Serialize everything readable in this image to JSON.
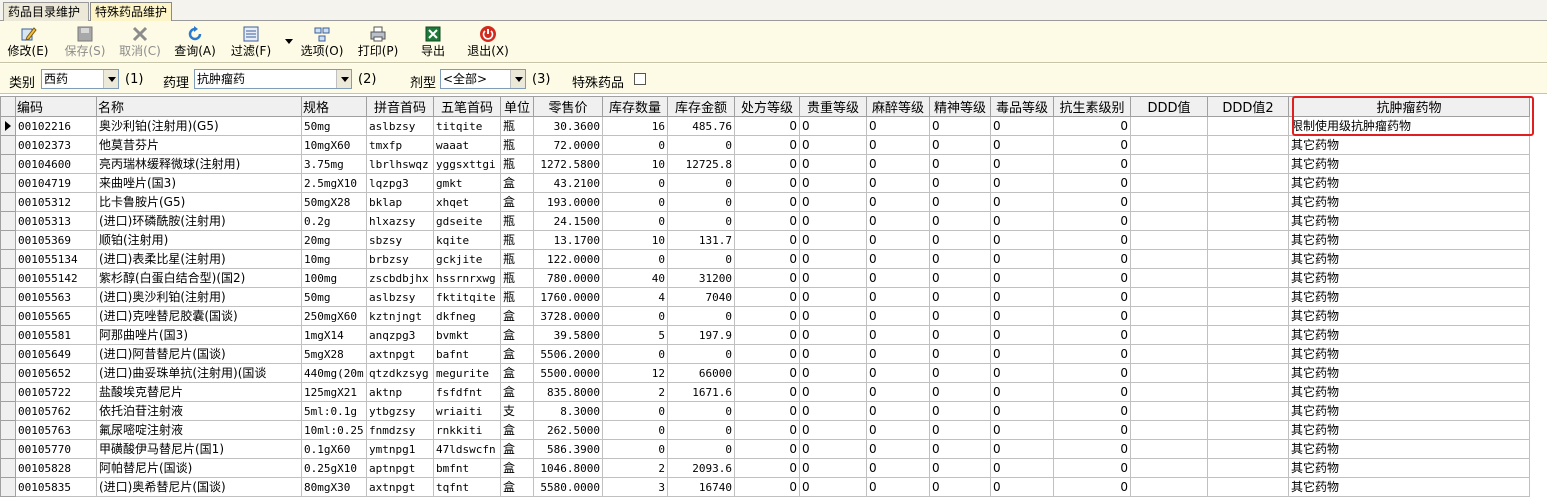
{
  "tabs": [
    {
      "label": "药品目录维护"
    },
    {
      "label": "特殊药品维护"
    }
  ],
  "toolbar": {
    "buttons": [
      {
        "label": "修改(E)",
        "icon": "edit-icon",
        "enabled": true
      },
      {
        "label": "保存(S)",
        "icon": "save-icon",
        "enabled": false
      },
      {
        "label": "取消(C)",
        "icon": "cancel-icon",
        "enabled": false
      },
      {
        "label": "查询(A)",
        "icon": "refresh-icon",
        "enabled": true
      },
      {
        "label": "过滤(F)",
        "icon": "filter-icon",
        "enabled": true
      },
      {
        "label": "选项(O)",
        "icon": "options-icon",
        "enabled": true
      },
      {
        "label": "打印(P)",
        "icon": "print-icon",
        "enabled": true
      },
      {
        "label": "导出",
        "icon": "excel-export-icon",
        "enabled": true
      },
      {
        "label": "退出(X)",
        "icon": "exit-power-icon",
        "enabled": true
      }
    ]
  },
  "filters": {
    "category_label": "类别",
    "category_value": "西药",
    "category_shortcut": "(1)",
    "pharm_label": "药理",
    "pharm_value": "抗肿瘤药",
    "pharm_shortcut": "(2)",
    "form_label": "剂型",
    "form_value": "<全部>",
    "form_shortcut": "(3)",
    "special_label": "特殊药品",
    "special_checked": false
  },
  "grid": {
    "columns": [
      "编码",
      "名称",
      "规格",
      "拼音首码",
      "五笔首码",
      "单位",
      "零售价",
      "库存数量",
      "库存金额",
      "处方等级",
      "贵重等级",
      "麻醉等级",
      "精神等级",
      "毒品等级",
      "抗生素级别",
      "DDD值",
      "DDD值2",
      "抗肿瘤药物"
    ],
    "rows": [
      [
        "00102216",
        "奥沙利铂(注射用)(G5)",
        "50mg",
        "aslbzsy",
        "titqite",
        "瓶",
        "30.3600",
        "16",
        "485.76",
        "0",
        "0",
        "0",
        "0",
        "0",
        "0",
        "",
        "",
        "限制使用级抗肿瘤药物"
      ],
      [
        "00102373",
        "他莫昔芬片",
        "10mgX60",
        "tmxfp",
        "waaat",
        "瓶",
        "72.0000",
        "0",
        "0",
        "0",
        "0",
        "0",
        "0",
        "0",
        "0",
        "",
        "",
        "其它药物"
      ],
      [
        "00104600",
        "亮丙瑞林缓释微球(注射用)",
        "3.75mg",
        "lbrlhswqz",
        "yggsxttgi",
        "瓶",
        "1272.5800",
        "10",
        "12725.8",
        "0",
        "0",
        "0",
        "0",
        "0",
        "0",
        "",
        "",
        "其它药物"
      ],
      [
        "00104719",
        "来曲唑片(国3)",
        "2.5mgX10",
        "lqzpg3",
        "gmkt",
        "盒",
        "43.2100",
        "0",
        "0",
        "0",
        "0",
        "0",
        "0",
        "0",
        "0",
        "",
        "",
        "其它药物"
      ],
      [
        "00105312",
        "比卡鲁胺片(G5)",
        "50mgX28",
        "bklap",
        "xhqet",
        "盒",
        "193.0000",
        "0",
        "0",
        "0",
        "0",
        "0",
        "0",
        "0",
        "0",
        "",
        "",
        "其它药物"
      ],
      [
        "00105313",
        "(进口)环磷酰胺(注射用)",
        "0.2g",
        "hlxazsy",
        "gdseite",
        "瓶",
        "24.1500",
        "0",
        "0",
        "0",
        "0",
        "0",
        "0",
        "0",
        "0",
        "",
        "",
        "其它药物"
      ],
      [
        "00105369",
        "顺铂(注射用)",
        "20mg",
        "sbzsy",
        "kqite",
        "瓶",
        "13.1700",
        "10",
        "131.7",
        "0",
        "0",
        "0",
        "0",
        "0",
        "0",
        "",
        "",
        "其它药物"
      ],
      [
        "001055134",
        "(进口)表柔比星(注射用)",
        "10mg",
        "brbzsy",
        "gckjite",
        "瓶",
        "122.0000",
        "0",
        "0",
        "0",
        "0",
        "0",
        "0",
        "0",
        "0",
        "",
        "",
        "其它药物"
      ],
      [
        "001055142",
        "紫杉醇(白蛋白结合型)(国2)",
        "100mg",
        "zscbdbjhx",
        "hssrnrxwg",
        "瓶",
        "780.0000",
        "40",
        "31200",
        "0",
        "0",
        "0",
        "0",
        "0",
        "0",
        "",
        "",
        "其它药物"
      ],
      [
        "00105563",
        "(进口)奥沙利铂(注射用)",
        "50mg",
        "aslbzsy",
        "fktitqite",
        "瓶",
        "1760.0000",
        "4",
        "7040",
        "0",
        "0",
        "0",
        "0",
        "0",
        "0",
        "",
        "",
        "其它药物"
      ],
      [
        "00105565",
        "(进口)克唑替尼胶囊(国谈)",
        "250mgX60",
        "kztnjngt",
        "dkfneg",
        "盒",
        "3728.0000",
        "0",
        "0",
        "0",
        "0",
        "0",
        "0",
        "0",
        "0",
        "",
        "",
        "其它药物"
      ],
      [
        "00105581",
        "阿那曲唑片(国3)",
        "1mgX14",
        "anqzpg3",
        "bvmkt",
        "盒",
        "39.5800",
        "5",
        "197.9",
        "0",
        "0",
        "0",
        "0",
        "0",
        "0",
        "",
        "",
        "其它药物"
      ],
      [
        "00105649",
        "(进口)阿昔替尼片(国谈)",
        "5mgX28",
        "axtnpgt",
        "bafnt",
        "盒",
        "5506.2000",
        "0",
        "0",
        "0",
        "0",
        "0",
        "0",
        "0",
        "0",
        "",
        "",
        "其它药物"
      ],
      [
        "00105652",
        "(进口)曲妥珠单抗(注射用)(国谈",
        "440mg(20m",
        "qtzdkzsyg",
        "megurite",
        "盒",
        "5500.0000",
        "12",
        "66000",
        "0",
        "0",
        "0",
        "0",
        "0",
        "0",
        "",
        "",
        "其它药物"
      ],
      [
        "00105722",
        "盐酸埃克替尼片",
        "125mgX21",
        "aktnp",
        "fsfdfnt",
        "盒",
        "835.8000",
        "2",
        "1671.6",
        "0",
        "0",
        "0",
        "0",
        "0",
        "0",
        "",
        "",
        "其它药物"
      ],
      [
        "00105762",
        "依托泊苷注射液",
        "5ml:0.1g",
        "ytbgzsy",
        "wriaiti",
        "支",
        "8.3000",
        "0",
        "0",
        "0",
        "0",
        "0",
        "0",
        "0",
        "0",
        "",
        "",
        "其它药物"
      ],
      [
        "00105763",
        "氟尿嘧啶注射液",
        "10ml:0.25",
        "fnmdzsy",
        "rnkkiti",
        "盒",
        "262.5000",
        "0",
        "0",
        "0",
        "0",
        "0",
        "0",
        "0",
        "0",
        "",
        "",
        "其它药物"
      ],
      [
        "00105770",
        "甲磺酸伊马替尼片(国1)",
        "0.1gX60",
        "ymtnpg1",
        "47ldswcfn",
        "盒",
        "586.3900",
        "0",
        "0",
        "0",
        "0",
        "0",
        "0",
        "0",
        "0",
        "",
        "",
        "其它药物"
      ],
      [
        "00105828",
        "阿帕替尼片(国谈)",
        "0.25gX10",
        "aptnpgt",
        "bmfnt",
        "盒",
        "1046.8000",
        "2",
        "2093.6",
        "0",
        "0",
        "0",
        "0",
        "0",
        "0",
        "",
        "",
        "其它药物"
      ],
      [
        "00105835",
        "(进口)奥希替尼片(国谈)",
        "80mgX30",
        "axtnpgt",
        "tqfnt",
        "盒",
        "5580.0000",
        "3",
        "16740",
        "0",
        "0",
        "0",
        "0",
        "0",
        "0",
        "",
        "",
        "其它药物"
      ]
    ]
  },
  "colors": {
    "toolbar_bg": "#fdfbe5",
    "active_tab_bg": "#fdf5c8",
    "highlight_border": "#e02020",
    "header_bg": "#f0f0f0"
  }
}
